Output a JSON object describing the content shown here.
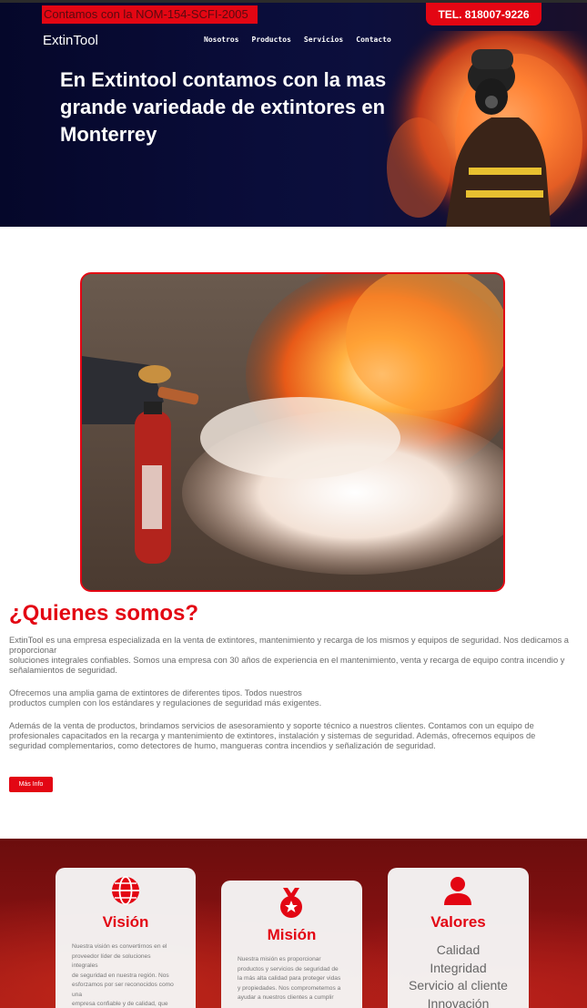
{
  "header": {
    "nom_banner": "Contamos con la NOM-154-SCFI-2005",
    "phone": "TEL. 818007-9226",
    "brand": "ExtinTool",
    "nav": [
      "Nosotros",
      "Productos",
      "Servicios",
      "Contacto"
    ],
    "hero_title": "En Extintool contamos con la mas grande variedade de extintores en Monterrey"
  },
  "about": {
    "title": "¿Quienes somos?",
    "paragraph_1": [
      "ExtinTool es una empresa especializada en la venta de extintores, mantenimiento y recarga de los mismos y equipos de seguridad. Nos dedicamos a proporcionar",
      "soluciones integrales confiables. Somos una empresa con 30 años de experiencia en el mantenimiento, venta y recarga de equipo contra incendio y señalamientos de seguridad."
    ],
    "paragraph_2": [
      "Ofrecemos una amplia gama de extintores de diferentes tipos. Todos nuestros",
      "productos cumplen con los estándares y regulaciones de seguridad más exigentes."
    ],
    "paragraph_3": "Además de la venta de productos, brindamos servicios de asesoramiento y soporte técnico a nuestros clientes. Contamos con un equipo de profesionales capacitados en la recarga y mantenimiento de extintores, instalación y sistemas de seguridad. Además, ofrecemos equipos de seguridad complementarios, como detectores de humo, mangueras contra incendios y señalización de seguridad.",
    "button": "Más Info"
  },
  "cards": {
    "vision": {
      "title": "Visión",
      "icon": "globe-icon",
      "text": [
        "Nuestra visión es convertirnos en el",
        "proveedor líder de soluciones",
        "integrales",
        "de seguridad en nuestra región. Nos",
        "esforzamos por ser reconocidos como",
        "una",
        "empresa confiable y de calidad, que"
      ]
    },
    "mision": {
      "title": "Misión",
      "icon": "medal-icon",
      "text": [
        "Nuestra misión es proporcionar",
        "productos y servicios de seguridad de",
        "la más alta calidad para proteger vidas",
        "y propiedades. Nos comprometemos a",
        "ayudar a nuestros clientes a cumplir"
      ]
    },
    "valores": {
      "title": "Valores",
      "icon": "user-icon",
      "items": [
        "Calidad",
        "Integridad",
        "Servicio al cliente",
        "Innovación"
      ]
    }
  },
  "colors": {
    "accent": "#e30613",
    "hero_bg": "#0a0d3a",
    "section_bg": "#8a1212"
  }
}
